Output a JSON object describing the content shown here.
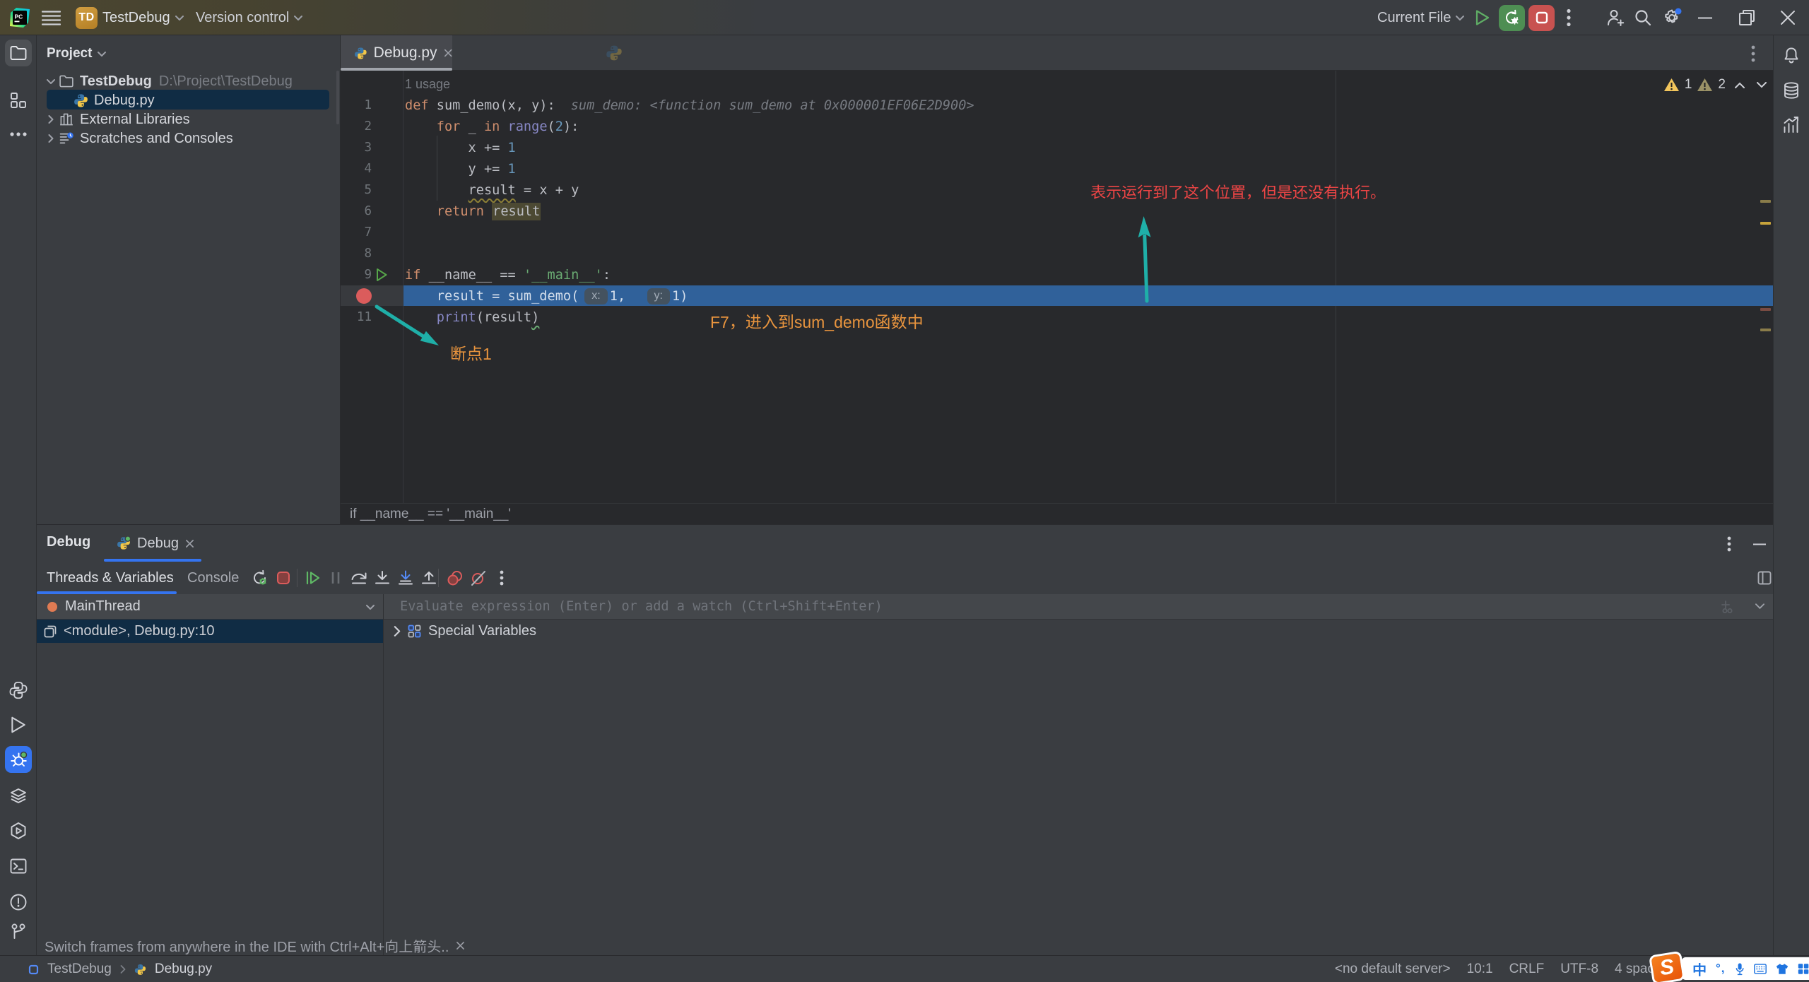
{
  "title_bar": {
    "project_badge": "TD",
    "project_name": "TestDebug",
    "vcs_label": "Version control",
    "run_config": "Current File"
  },
  "project_panel": {
    "header": "Project",
    "root_name": "TestDebug",
    "root_path": "D:\\Project\\TestDebug",
    "file_name": "Debug.py",
    "external_libs": "External Libraries",
    "scratches": "Scratches and Consoles"
  },
  "editor": {
    "tab_title": "Debug.py",
    "usage_hint": "1 usage",
    "inspections": {
      "warnings": "1",
      "weak_warnings": "2"
    },
    "breadcrumb": "if __name__ == '__main__'",
    "annotations": {
      "exec_note": "表示运行到了这个位置，但是还没有执行。",
      "f7_note": "F7，进入到sum_demo函数中",
      "breakpoint_label": "断点1"
    },
    "code_lines": [
      {
        "n": 1,
        "tokens": [
          [
            "k",
            "def "
          ],
          [
            "p",
            "sum_demo(x, y):"
          ]
        ],
        "hint": "sum_demo: <function sum_demo at 0x000001EF06E2D900>"
      },
      {
        "n": 2,
        "tokens": [
          [
            "p",
            "    "
          ],
          [
            "k",
            "for "
          ],
          [
            "p",
            "_ "
          ],
          [
            "k",
            "in "
          ],
          [
            "b",
            "range"
          ],
          [
            "p",
            "("
          ],
          [
            "n",
            "2"
          ],
          [
            "p",
            "):"
          ]
        ]
      },
      {
        "n": 3,
        "tokens": [
          [
            "p",
            "        x += "
          ],
          [
            "n",
            "1"
          ]
        ]
      },
      {
        "n": 4,
        "tokens": [
          [
            "p",
            "        y += "
          ],
          [
            "n",
            "1"
          ]
        ]
      },
      {
        "n": 5,
        "tokens": [
          [
            "p",
            "        "
          ],
          [
            "warn",
            "result"
          ],
          [
            "p",
            " = x + y"
          ]
        ]
      },
      {
        "n": 6,
        "tokens": [
          [
            "p",
            "    "
          ],
          [
            "k",
            "return "
          ],
          [
            "hl",
            "result"
          ]
        ]
      },
      {
        "n": 7,
        "tokens": []
      },
      {
        "n": 8,
        "tokens": []
      },
      {
        "n": 9,
        "tokens": [
          [
            "k",
            "if "
          ],
          [
            "p",
            "__name__ == "
          ],
          [
            "s",
            "'__main__'"
          ],
          [
            "p",
            ":"
          ]
        ],
        "gutter": "run"
      },
      {
        "n": 10,
        "tokens": [
          [
            "p",
            "    result = sum_demo("
          ],
          [
            "chip",
            "x:"
          ],
          [
            "n",
            "1"
          ],
          [
            "p",
            ",  "
          ],
          [
            "chip",
            "y:"
          ],
          [
            "n",
            "1"
          ],
          [
            "p",
            ")"
          ]
        ],
        "gutter": "breakpoint",
        "exec": true
      },
      {
        "n": 11,
        "tokens": [
          [
            "p",
            "    "
          ],
          [
            "b",
            "print"
          ],
          [
            "p",
            "(result"
          ],
          [
            "sq",
            ")"
          ]
        ]
      }
    ]
  },
  "debug_panel": {
    "title": "Debug",
    "session_tab": "Debug",
    "tabs": [
      "Threads & Variables",
      "Console"
    ],
    "thread": "MainThread",
    "frame": "<module>, Debug.py:10",
    "evaluate_placeholder": "Evaluate expression (Enter) or add a watch (Ctrl+Shift+Enter)",
    "special_variables": "Special Variables",
    "hint": "Switch frames from anywhere in the IDE with Ctrl+Alt+向上箭头.."
  },
  "status_bar": {
    "breadcrumb_project": "TestDebug",
    "breadcrumb_file": "Debug.py",
    "server": "<no default server>",
    "caret": "10:1",
    "line_ending": "CRLF",
    "encoding": "UTF-8",
    "indent": "4 spac"
  },
  "sogou": {
    "lang": "中",
    "punct": "°,"
  },
  "colors": {
    "accent_blue": "#3574F0",
    "execution_line": "#38689F",
    "breakpoint_red": "#DB5C5C",
    "annotation_red": "#ED4545",
    "annotation_orange": "#E8943E",
    "annotation_teal": "#1FAFA8",
    "editor_bg": "#1E1F22",
    "panel_bg": "#2B2D30"
  }
}
